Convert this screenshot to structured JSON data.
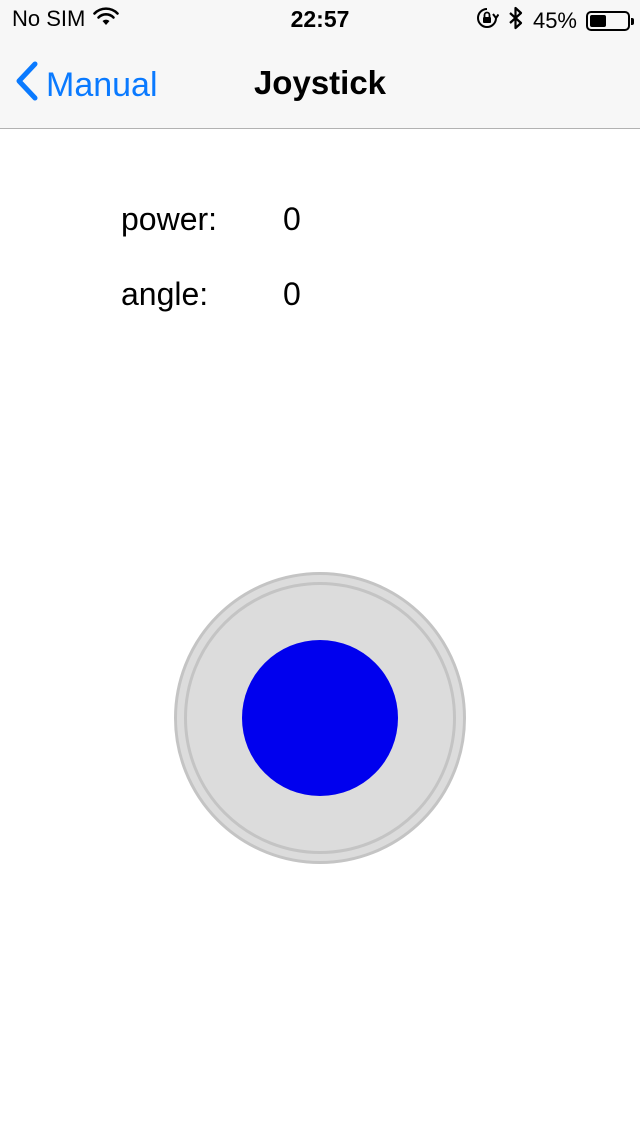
{
  "status_bar": {
    "carrier": "No SIM",
    "time": "22:57",
    "battery_percent": "45%",
    "battery_level": 0.45,
    "icons": [
      "wifi-icon",
      "rotation-lock-icon",
      "bluetooth-icon",
      "battery-icon"
    ]
  },
  "nav": {
    "back_label": "Manual",
    "title": "Joystick",
    "accent_color": "#0a7aff"
  },
  "readouts": {
    "power_label": "power:",
    "power_value": "0",
    "angle_label": "angle:",
    "angle_value": "0"
  },
  "joystick": {
    "knob_color": "#0000ee",
    "base_color": "#dcdcdc",
    "ring_color": "#c4c4c4"
  }
}
